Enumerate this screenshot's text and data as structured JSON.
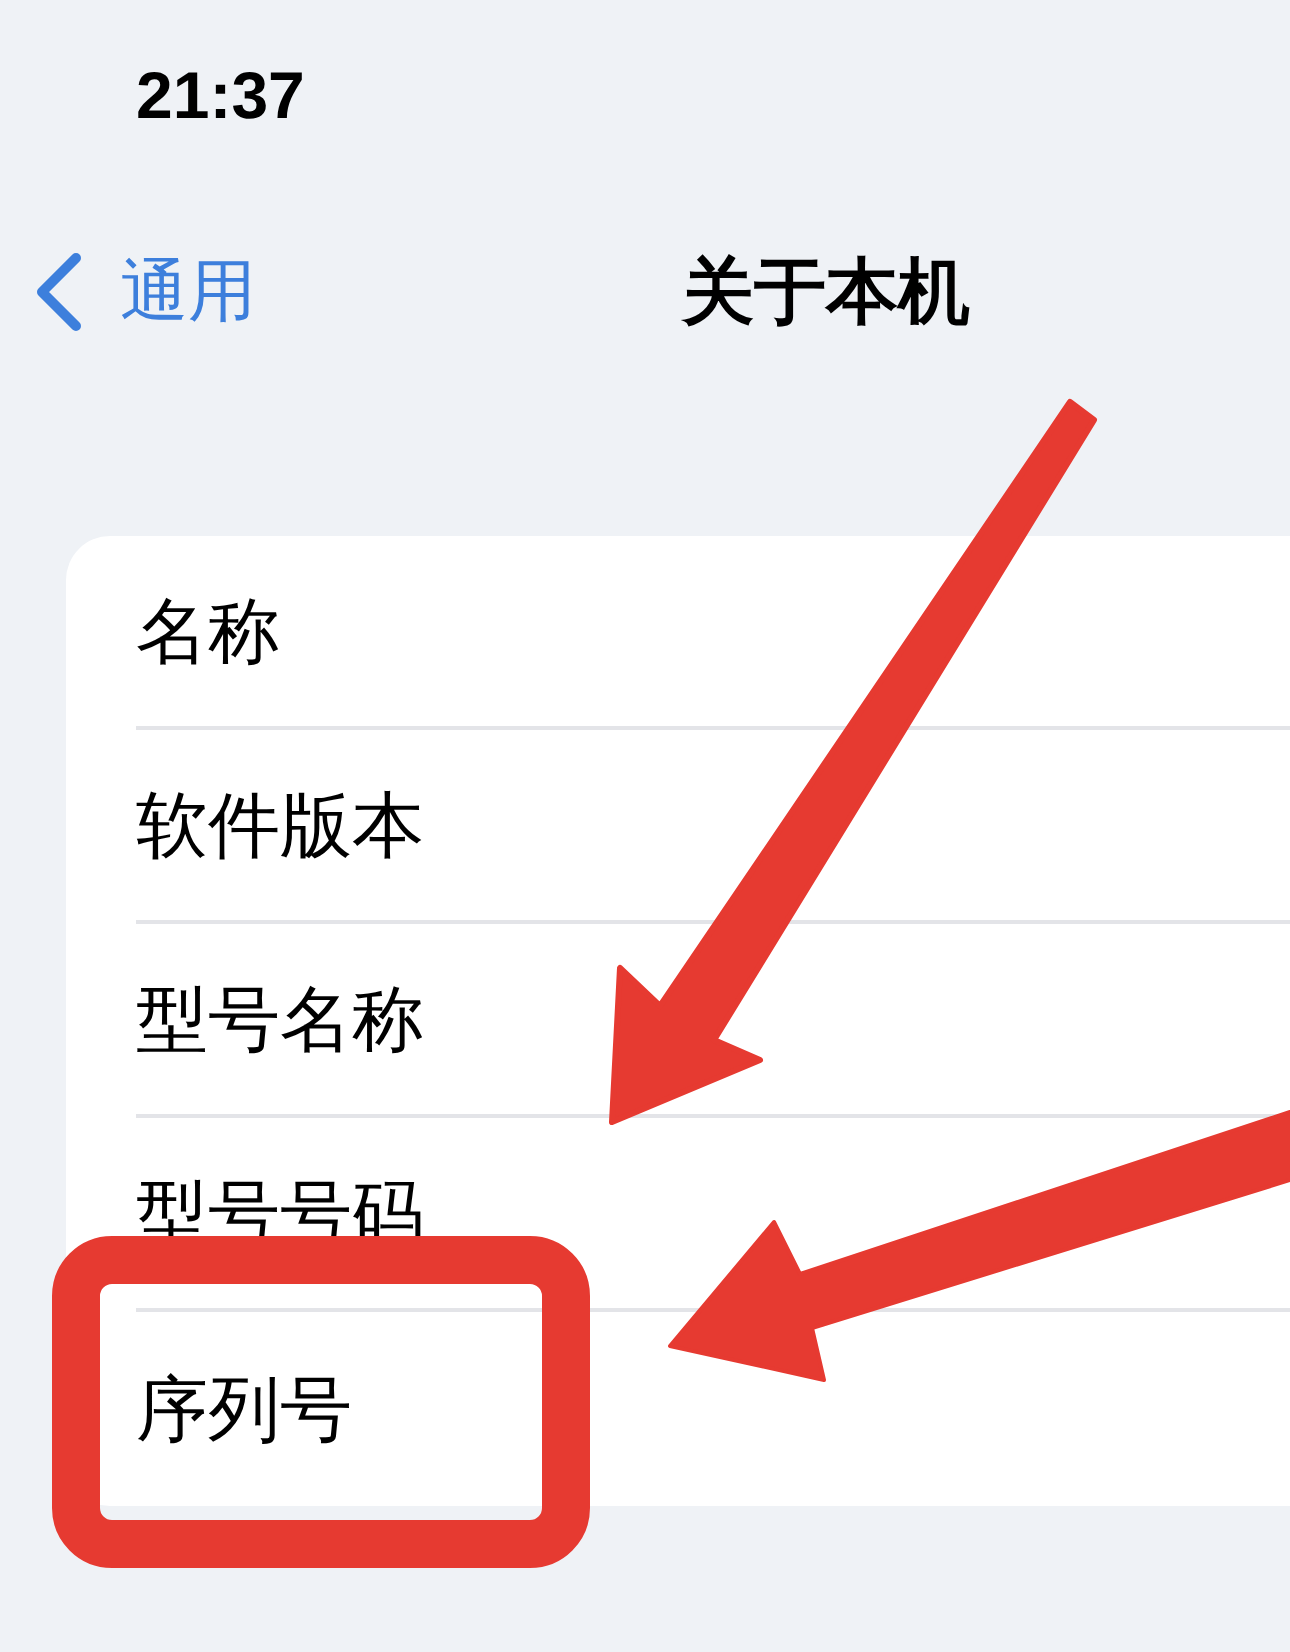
{
  "status_bar": {
    "time": "21:37"
  },
  "nav_bar": {
    "back_label": "通用",
    "title": "关于本机"
  },
  "rows": [
    {
      "label": "名称"
    },
    {
      "label": "软件版本"
    },
    {
      "label": "型号名称"
    },
    {
      "label": "型号号码"
    },
    {
      "label": "序列号"
    }
  ]
}
